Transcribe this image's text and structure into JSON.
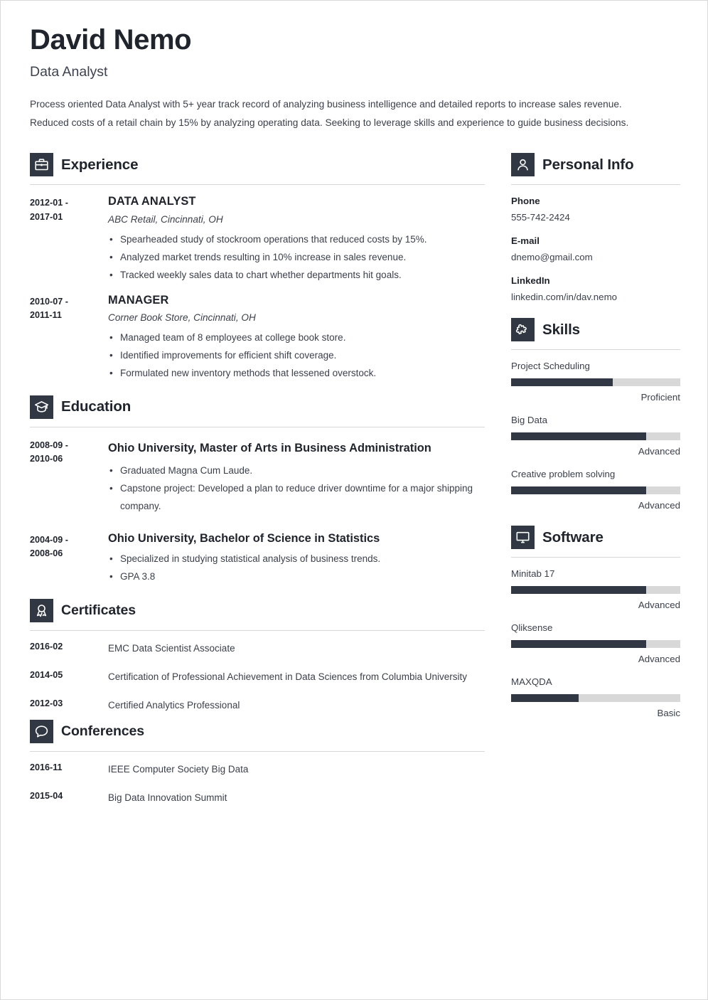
{
  "colors": {
    "ink": "#20242d",
    "body_text": "#3a3f4b",
    "icon_block": "#313844",
    "bar_track": "#d8d8d8",
    "bar_fill": "#313844",
    "rule": "#d7d7d7"
  },
  "header": {
    "name": "David Nemo",
    "role": "Data Analyst",
    "summary": "Process oriented Data Analyst with 5+ year track record of analyzing business intelligence and detailed reports to increase sales revenue. Reduced costs of a retail chain by 15% by analyzing operating data. Seeking to leverage skills and experience to guide business decisions."
  },
  "experience": {
    "title": "Experience",
    "icon": "briefcase-icon",
    "entries": [
      {
        "date_start": "2012-01 -",
        "date_end": "2017-01",
        "title": "DATA ANALYST",
        "org": "ABC Retail, Cincinnati, OH",
        "bullets": [
          "Spearheaded study of stockroom operations that reduced costs by 15%.",
          "Analyzed market trends resulting in 10% increase in sales revenue.",
          "Tracked weekly sales data to chart whether departments hit goals."
        ]
      },
      {
        "date_start": "2010-07 -",
        "date_end": "2011-11",
        "title": "MANAGER",
        "org": "Corner Book Store, Cincinnati, OH",
        "bullets": [
          "Managed team of 8 employees at college book store.",
          "Identified improvements for efficient shift coverage.",
          "Formulated new inventory methods that lessened overstock."
        ]
      }
    ]
  },
  "education": {
    "title": "Education",
    "icon": "graduation-cap-icon",
    "entries": [
      {
        "date_start": "2008-09 -",
        "date_end": "2010-06",
        "title": "Ohio University, Master of Arts in Business Administration",
        "bullets": [
          "Graduated Magna Cum Laude.",
          "Capstone project: Developed a plan to reduce driver downtime for a major shipping company."
        ]
      },
      {
        "date_start": "2004-09 -",
        "date_end": "2008-06",
        "title": "Ohio University, Bachelor of Science in Statistics",
        "bullets": [
          "Specialized in studying statistical analysis of business trends.",
          "GPA 3.8"
        ]
      }
    ]
  },
  "certificates": {
    "title": "Certificates",
    "icon": "award-ribbon-icon",
    "entries": [
      {
        "date": "2016-02",
        "text": "EMC Data Scientist Associate"
      },
      {
        "date": "2014-05",
        "text": "Certification of Professional Achievement in Data Sciences from Columbia University"
      },
      {
        "date": "2012-03",
        "text": "Certified Analytics Professional"
      }
    ]
  },
  "conferences": {
    "title": "Conferences",
    "icon": "speech-bubble-icon",
    "entries": [
      {
        "date": "2016-11",
        "text": "IEEE Computer Society Big Data"
      },
      {
        "date": "2015-04",
        "text": "Big Data Innovation Summit"
      }
    ]
  },
  "personal_info": {
    "title": "Personal Info",
    "icon": "person-icon",
    "items": [
      {
        "label": "Phone",
        "value": "555-742-2424"
      },
      {
        "label": "E-mail",
        "value": "dnemo@gmail.com"
      },
      {
        "label": "LinkedIn",
        "value": "linkedin.com/in/dav.nemo"
      }
    ]
  },
  "skills": {
    "title": "Skills",
    "icon": "puzzle-piece-icon",
    "items": [
      {
        "name": "Project Scheduling",
        "level": "Proficient",
        "percent": 60
      },
      {
        "name": "Big Data",
        "level": "Advanced",
        "percent": 80
      },
      {
        "name": "Creative problem solving",
        "level": "Advanced",
        "percent": 80
      }
    ]
  },
  "software": {
    "title": "Software",
    "icon": "monitor-icon",
    "items": [
      {
        "name": "Minitab 17",
        "level": "Advanced",
        "percent": 80
      },
      {
        "name": "Qliksense",
        "level": "Advanced",
        "percent": 80
      },
      {
        "name": "MAXQDA",
        "level": "Basic",
        "percent": 40
      }
    ]
  }
}
